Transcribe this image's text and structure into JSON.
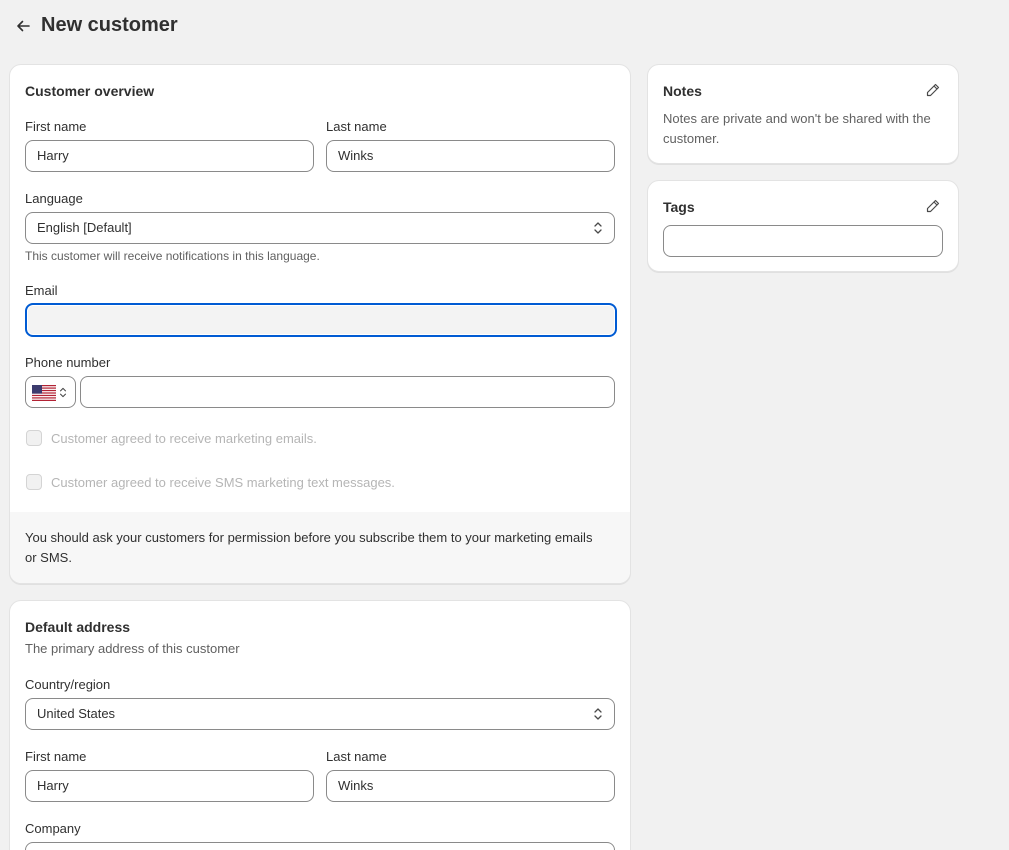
{
  "header": {
    "title": "New customer"
  },
  "overview": {
    "title": "Customer overview",
    "first_name_label": "First name",
    "first_name_value": "Harry",
    "last_name_label": "Last name",
    "last_name_value": "Winks",
    "language_label": "Language",
    "language_value": "English [Default]",
    "language_help": "This customer will receive notifications in this language.",
    "email_label": "Email",
    "email_value": "",
    "phone_label": "Phone number",
    "phone_country_flag": "us-flag-icon",
    "phone_value": "",
    "marketing_email_label": "Customer agreed to receive marketing emails.",
    "marketing_sms_label": "Customer agreed to receive SMS marketing text messages.",
    "notice": "You should ask your customers for permission before you subscribe them to your marketing emails or SMS."
  },
  "address": {
    "title": "Default address",
    "subtitle": "The primary address of this customer",
    "country_label": "Country/region",
    "country_value": "United States",
    "first_name_label": "First name",
    "first_name_value": "Harry",
    "last_name_label": "Last name",
    "last_name_value": "Winks",
    "company_label": "Company"
  },
  "notes": {
    "title": "Notes",
    "text": "Notes are private and won't be shared with the customer."
  },
  "tags": {
    "title": "Tags",
    "value": ""
  },
  "colors": {
    "focus": "#005bd3",
    "background": "#f1f1f1",
    "text": "#303030"
  }
}
